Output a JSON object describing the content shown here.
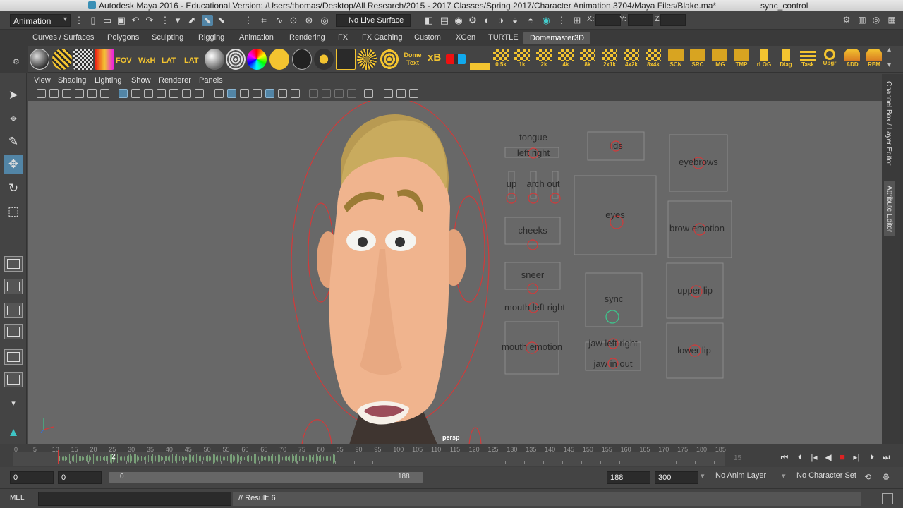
{
  "window": {
    "title": "Autodesk Maya 2016 - Educational Version: /Users/thomas/Desktop/All Research/2015 - 2017 Classes/Spring 2017/Character Animation 3704/Maya Files/Blake.ma*",
    "selection_title": "sync_control"
  },
  "status_line": {
    "menu_set": "Animation",
    "live_surface": "No Live Surface",
    "coord_x": "X:",
    "coord_y": "Y:",
    "coord_z": "Z:"
  },
  "shelf": {
    "tabs": [
      "Curves / Surfaces",
      "Polygons",
      "Sculpting",
      "Rigging",
      "Animation",
      "Rendering",
      "FX",
      "FX Caching",
      "Custom",
      "XGen",
      "TURTLE",
      "Domemaster3D"
    ],
    "active_tab": "Domemaster3D",
    "text_buttons": [
      "FOV",
      "WxH",
      "LAT",
      "LAT",
      "Dome Text",
      "xB"
    ],
    "icon_buttons": [
      "0.5k",
      "1k",
      "2k",
      "4k",
      "8k",
      "2x1k",
      "4x2k",
      "8x4k",
      "SCN",
      "SRC",
      "IMG",
      "TMP",
      "rLOG",
      "Diag",
      "Task",
      "Upgr",
      "ADD",
      "REM"
    ]
  },
  "panel": {
    "menus": [
      "View",
      "Shading",
      "Lighting",
      "Show",
      "Renderer",
      "Panels"
    ],
    "camera_label": "persp"
  },
  "face_controls": {
    "labels": {
      "tongue": "tongue",
      "tongue_lr": "left right",
      "up": "up",
      "arch_out": "arch out",
      "lids": "lids",
      "eyebrows": "eyebrows",
      "cheeks": "cheeks",
      "eyes": "eyes",
      "brow_emotion": "brow emotion",
      "sneer": "sneer",
      "mouth_lr": "mouth left right",
      "sync": "sync",
      "upper_lip": "upper lip",
      "mouth_emotion": "mouth emotion",
      "jaw_lr": "jaw left right",
      "jaw_io": "jaw in out",
      "lower_lip": "lower lip"
    }
  },
  "time_slider": {
    "ticks": [
      0,
      5,
      10,
      15,
      20,
      25,
      30,
      35,
      40,
      45,
      50,
      55,
      60,
      65,
      70,
      75,
      80,
      85,
      90,
      95,
      100,
      105,
      110,
      115,
      120,
      125,
      130,
      135,
      140,
      145,
      150,
      155,
      160,
      165,
      170,
      175,
      180,
      185
    ],
    "current_frame": "15",
    "playhead_frame": 12,
    "cursor_frame_label": "2"
  },
  "range_slider": {
    "start_time": "0",
    "playback_start": "0",
    "bar_start": "0",
    "bar_end": "188",
    "playback_end": "188",
    "end_time": "300",
    "anim_layer": "No Anim Layer",
    "character_set": "No Character Set"
  },
  "command_line": {
    "mode": "MEL",
    "result": "// Result: 6"
  },
  "right_tabs": {
    "channel_box": "Channel Box / Layer Editor",
    "attribute_editor": "Attribute Editor"
  },
  "colors": {
    "accent": "#5285a6",
    "control_curve": "#d13a3a",
    "sync_control": "#3ec48c"
  }
}
